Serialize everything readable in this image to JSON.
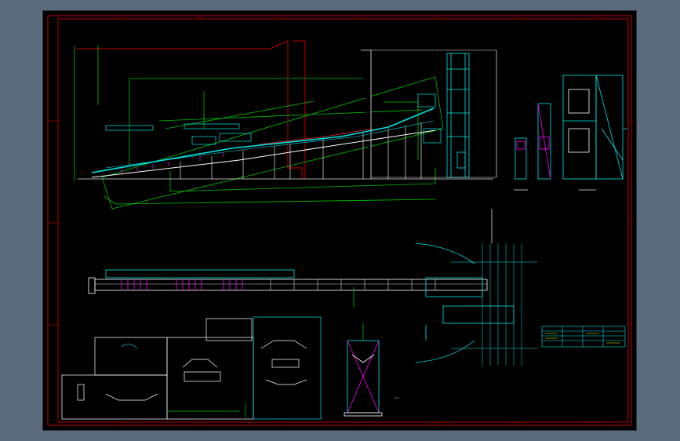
{
  "viewport": {
    "background": "#5a6a7b",
    "canvas_background": "#000000"
  },
  "colors": {
    "frame": "#c00000",
    "dimension": "#00c000",
    "steel": "#00e5e5",
    "member": "#ff00ff",
    "outline": "#ffffff",
    "building": "#c00000",
    "note": "#ffff00"
  },
  "title_block": {
    "rows": 4,
    "cols": 4
  },
  "drawing_text": {
    "note_mark": "1:1"
  }
}
